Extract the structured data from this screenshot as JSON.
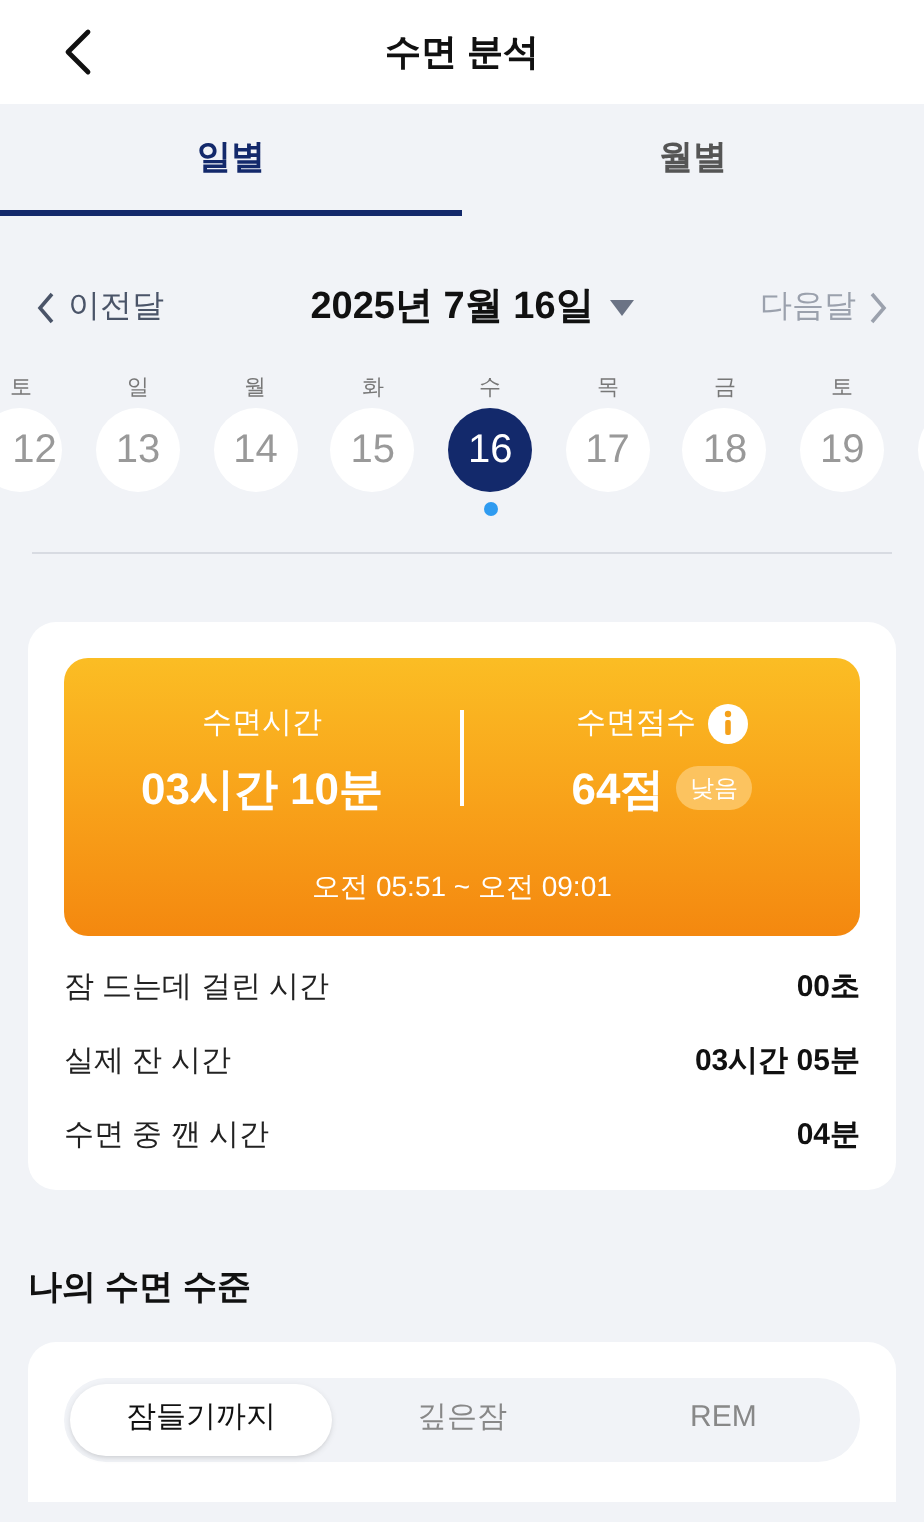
{
  "header": {
    "title": "수면 분석"
  },
  "tabs": [
    {
      "label": "일별",
      "selected": true
    },
    {
      "label": "월별",
      "selected": false
    }
  ],
  "date_nav": {
    "prev": "이전달",
    "date": "2025년 7월 16일",
    "next": "다음달",
    "next_disabled": true
  },
  "days": [
    {
      "weekday": "토",
      "day": "12",
      "selected": false,
      "has_record": false
    },
    {
      "weekday": "일",
      "day": "13",
      "selected": false,
      "has_record": false
    },
    {
      "weekday": "월",
      "day": "14",
      "selected": false,
      "has_record": false
    },
    {
      "weekday": "화",
      "day": "15",
      "selected": false,
      "has_record": false
    },
    {
      "weekday": "수",
      "day": "16",
      "selected": true,
      "has_record": true
    },
    {
      "weekday": "목",
      "day": "17",
      "selected": false,
      "has_record": false
    },
    {
      "weekday": "금",
      "day": "18",
      "selected": false,
      "has_record": false
    },
    {
      "weekday": "토",
      "day": "19",
      "selected": false,
      "has_record": false
    }
  ],
  "summary": {
    "time_label": "수면시간",
    "time_value": "03시간 10분",
    "score_label": "수면점수",
    "score_value": "64점",
    "score_badge": "낮음",
    "range": "오전 05:51 ~ 오전 09:01"
  },
  "stats": [
    {
      "label": "잠 드는데 걸린 시간",
      "value": "00초"
    },
    {
      "label": "실제 잔 시간",
      "value": "03시간 05분"
    },
    {
      "label": "수면 중 깬 시간",
      "value": "04분"
    }
  ],
  "level_section": {
    "title": "나의 수면 수준",
    "segments": [
      {
        "label": "잠들기까지",
        "selected": true
      },
      {
        "label": "깊은잠",
        "selected": false
      },
      {
        "label": "REM",
        "selected": false
      }
    ]
  }
}
